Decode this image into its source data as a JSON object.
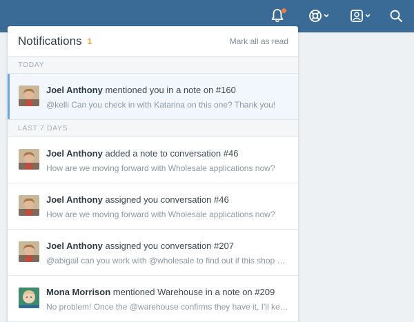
{
  "topbar": {
    "icons": [
      "bell-icon",
      "help-icon",
      "user-icon",
      "search-icon"
    ],
    "bell_has_unread": true,
    "colors": {
      "bar": "#3a6a96",
      "badge": "#ef7b3c"
    }
  },
  "panel": {
    "title": "Notifications",
    "count": "1",
    "mark_all_label": "Mark all as read"
  },
  "sections": [
    {
      "label": "TODAY",
      "items": [
        {
          "who": "Joel Anthony",
          "action": " mentioned you in a note on #160",
          "preview": "@kelli Can you check in with Katarina on this one? Thank you!",
          "avatar": "joel",
          "unread": true
        }
      ]
    },
    {
      "label": "LAST 7 DAYS",
      "items": [
        {
          "who": "Joel Anthony",
          "action": " added a note to conversation #46",
          "preview": "How are we moving forward with Wholesale applications now?",
          "avatar": "joel",
          "unread": false
        },
        {
          "who": "Joel Anthony",
          "action": " assigned you conversation #46",
          "preview": "How are we moving forward with Wholesale applications now?",
          "avatar": "joel",
          "unread": false
        },
        {
          "who": "Joel Anthony",
          "action": " assigned you conversation #207",
          "preview": "@abigail can you work with @wholesale to find out if this shop needs more",
          "avatar": "joel",
          "unread": false
        },
        {
          "who": "Mona Morrison",
          "action": " mentioned Warehouse in a note on #209",
          "preview": "No problem! Once the @warehouse confirms they have it, I'll keep you posted",
          "avatar": "mona",
          "unread": false
        }
      ]
    }
  ]
}
